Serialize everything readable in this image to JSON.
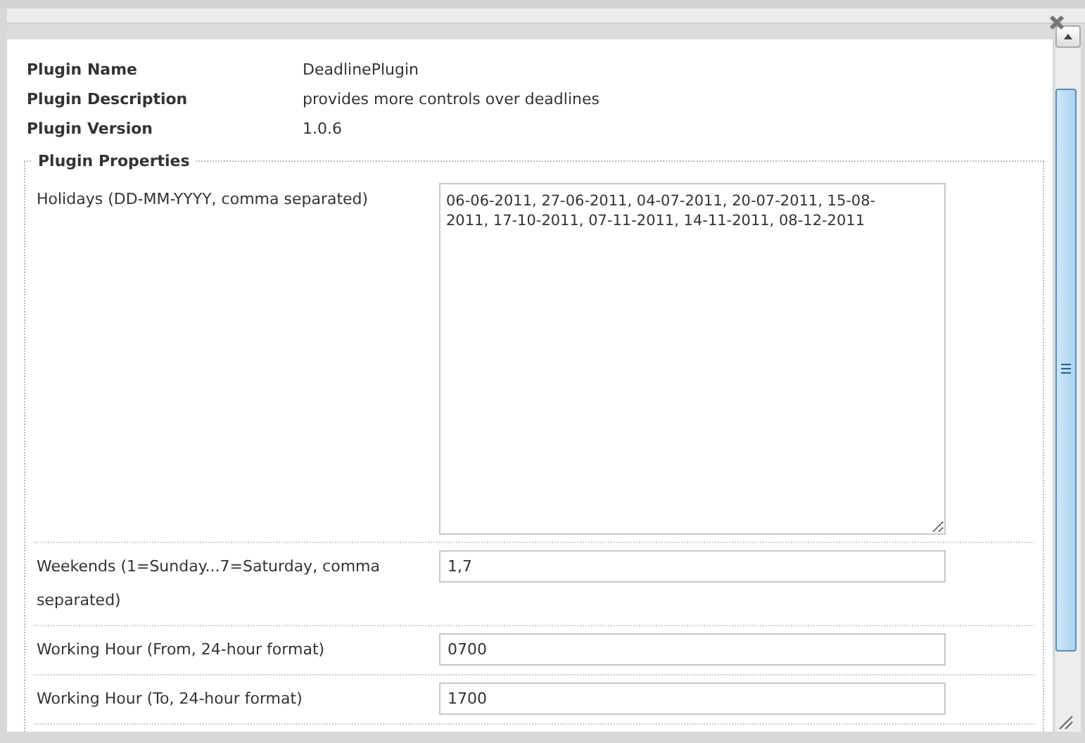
{
  "info": [
    {
      "label": "Plugin Name",
      "value": "DeadlinePlugin"
    },
    {
      "label": "Plugin Description",
      "value": "provides more controls over deadlines"
    },
    {
      "label": "Plugin Version",
      "value": "1.0.6"
    }
  ],
  "properties": {
    "legend": "Plugin Properties",
    "fields": [
      {
        "kind": "textarea",
        "label": "Holidays (DD-MM-YYYY, comma separated)",
        "value": "06-06-2011, 27-06-2011, 04-07-2011, 20-07-2011, 15-08-2011, 17-10-2011, 07-11-2011, 14-11-2011, 08-12-2011"
      },
      {
        "kind": "text",
        "label": "Weekends (1=Sunday...7=Saturday, comma separated)",
        "value": "1,7"
      },
      {
        "kind": "text",
        "label": "Working Hour (From, 24-hour format)",
        "value": "0700"
      },
      {
        "kind": "text",
        "label": "Working Hour (To, 24-hour format)",
        "value": "1700"
      }
    ]
  }
}
